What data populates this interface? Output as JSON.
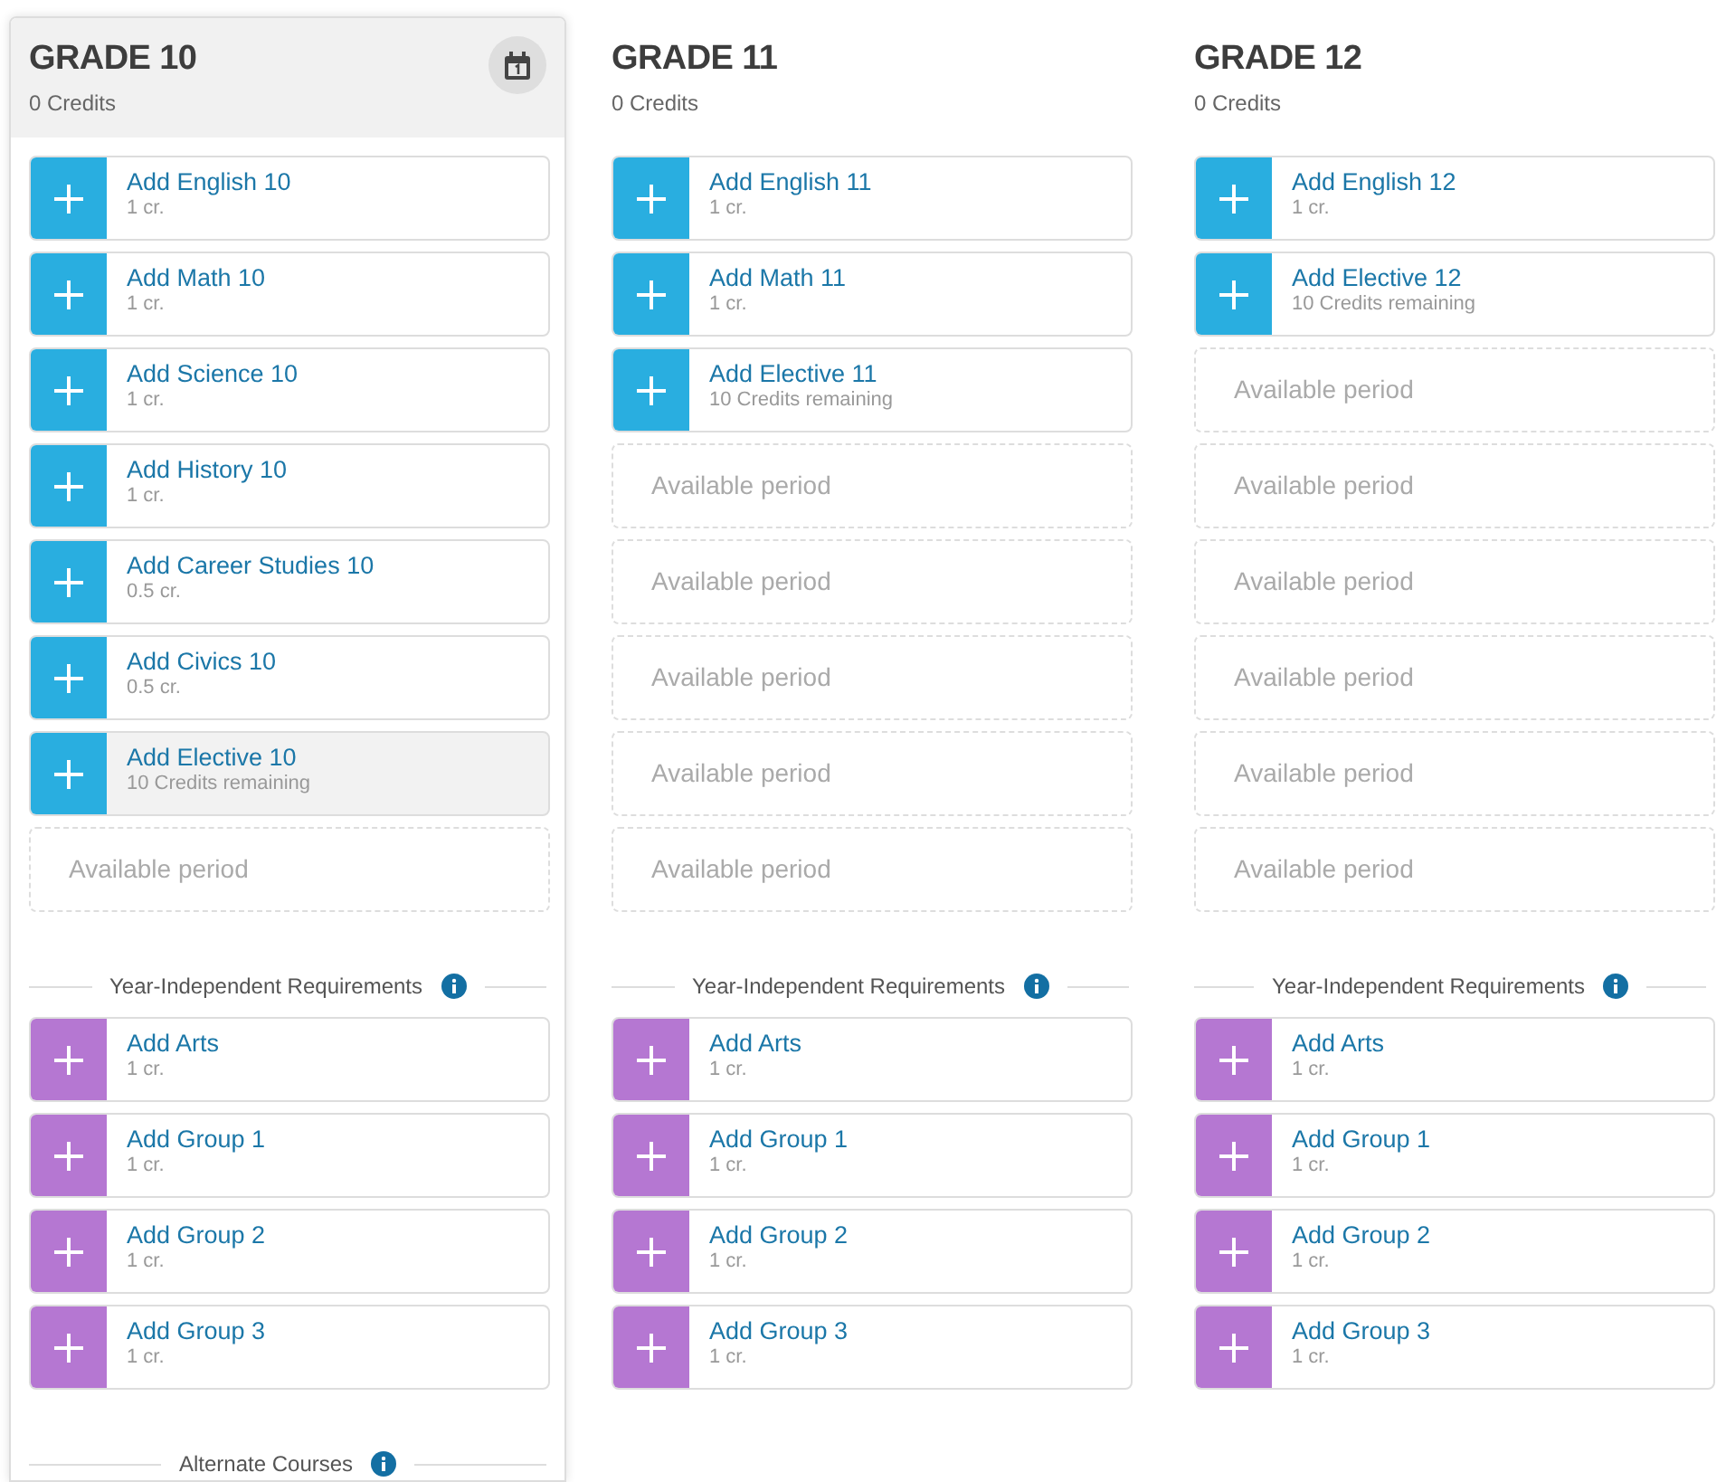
{
  "grades": [
    {
      "title": "GRADE 10",
      "credits": "0 Credits",
      "selected": true,
      "slots": [
        {
          "kind": "course",
          "name": "Add English 10",
          "credit": "1 cr.",
          "color": "#29aee0",
          "hovered": false
        },
        {
          "kind": "course",
          "name": "Add Math 10",
          "credit": "1 cr.",
          "color": "#29aee0",
          "hovered": false
        },
        {
          "kind": "course",
          "name": "Add Science 10",
          "credit": "1 cr.",
          "color": "#29aee0",
          "hovered": false
        },
        {
          "kind": "course",
          "name": "Add History 10",
          "credit": "1 cr.",
          "color": "#29aee0",
          "hovered": false
        },
        {
          "kind": "course",
          "name": "Add Career Studies 10",
          "credit": "0.5 cr.",
          "color": "#29aee0",
          "hovered": false
        },
        {
          "kind": "course",
          "name": "Add Civics 10",
          "credit": "0.5 cr.",
          "color": "#29aee0",
          "hovered": false
        },
        {
          "kind": "course",
          "name": "Add Elective 10",
          "credit": "10 Credits remaining",
          "color": "#29aee0",
          "hovered": true
        },
        {
          "kind": "available",
          "name": "Available period"
        }
      ],
      "sections": [
        {
          "heading": "Year-Independent Requirements",
          "courses": [
            {
              "name": "Add Arts",
              "credit": "1 cr.",
              "color": "#b577d2"
            },
            {
              "name": "Add Group 1",
              "credit": "1 cr.",
              "color": "#b577d2"
            },
            {
              "name": "Add Group 2",
              "credit": "1 cr.",
              "color": "#b577d2"
            },
            {
              "name": "Add Group 3",
              "credit": "1 cr.",
              "color": "#b577d2"
            }
          ]
        },
        {
          "heading": "Alternate Courses"
        }
      ]
    },
    {
      "title": "GRADE 11",
      "credits": "0 Credits",
      "selected": false,
      "slots": [
        {
          "kind": "course",
          "name": "Add English 11",
          "credit": "1 cr.",
          "color": "#29aee0",
          "hovered": false
        },
        {
          "kind": "course",
          "name": "Add Math 11",
          "credit": "1 cr.",
          "color": "#29aee0",
          "hovered": false
        },
        {
          "kind": "course",
          "name": "Add Elective 11",
          "credit": "10 Credits remaining",
          "color": "#29aee0",
          "hovered": false
        },
        {
          "kind": "available",
          "name": "Available period"
        },
        {
          "kind": "available",
          "name": "Available period"
        },
        {
          "kind": "available",
          "name": "Available period"
        },
        {
          "kind": "available",
          "name": "Available period"
        },
        {
          "kind": "available",
          "name": "Available period"
        }
      ],
      "sections": [
        {
          "heading": "Year-Independent Requirements",
          "courses": [
            {
              "name": "Add Arts",
              "credit": "1 cr.",
              "color": "#b577d2"
            },
            {
              "name": "Add Group 1",
              "credit": "1 cr.",
              "color": "#b577d2"
            },
            {
              "name": "Add Group 2",
              "credit": "1 cr.",
              "color": "#b577d2"
            },
            {
              "name": "Add Group 3",
              "credit": "1 cr.",
              "color": "#b577d2"
            }
          ]
        }
      ]
    },
    {
      "title": "GRADE 12",
      "credits": "0 Credits",
      "selected": false,
      "slots": [
        {
          "kind": "course",
          "name": "Add English 12",
          "credit": "1 cr.",
          "color": "#29aee0",
          "hovered": false
        },
        {
          "kind": "course",
          "name": "Add Elective 12",
          "credit": "10 Credits remaining",
          "color": "#29aee0",
          "hovered": false
        },
        {
          "kind": "available",
          "name": "Available period"
        },
        {
          "kind": "available",
          "name": "Available period"
        },
        {
          "kind": "available",
          "name": "Available period"
        },
        {
          "kind": "available",
          "name": "Available period"
        },
        {
          "kind": "available",
          "name": "Available period"
        },
        {
          "kind": "available",
          "name": "Available period"
        }
      ],
      "sections": [
        {
          "heading": "Year-Independent Requirements",
          "courses": [
            {
              "name": "Add Arts",
              "credit": "1 cr.",
              "color": "#b577d2"
            },
            {
              "name": "Add Group 1",
              "credit": "1 cr.",
              "color": "#b577d2"
            },
            {
              "name": "Add Group 2",
              "credit": "1 cr.",
              "color": "#b577d2"
            },
            {
              "name": "Add Group 3",
              "credit": "1 cr.",
              "color": "#b577d2"
            }
          ]
        }
      ]
    }
  ]
}
